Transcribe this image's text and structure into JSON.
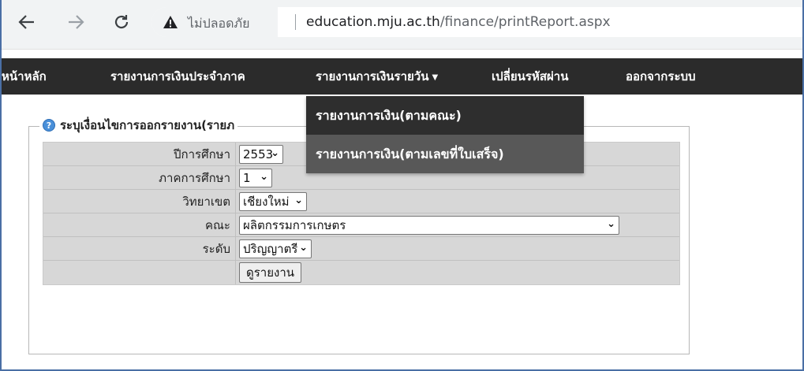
{
  "browser": {
    "security_label": "ไม่ปลอดภัย",
    "url_host": "education.mju.ac.th",
    "url_path": "/finance/printReport.aspx"
  },
  "menu": {
    "items": [
      {
        "label": "หน้าหลัก"
      },
      {
        "label": "รายงานการเงินประจำภาค"
      },
      {
        "label": "รายงานการเงินรายวัน"
      },
      {
        "label": "เปลี่ยนรหัสผ่าน"
      },
      {
        "label": "ออกจากระบบ"
      }
    ],
    "dropdown": [
      {
        "label": "รายงานการเงิน(ตามคณะ)"
      },
      {
        "label": "รายงานการเงิน(ตามเลขที่ใบเสร็จ)"
      }
    ]
  },
  "form": {
    "legend": "ระบุเงื่อนไขการออกรายงาน(รายภ",
    "fields": [
      {
        "label": "ปีการศึกษา",
        "value": "2553"
      },
      {
        "label": "ภาคการศึกษา",
        "value": "1"
      },
      {
        "label": "วิทยาเขต",
        "value": "เชียงใหม่"
      },
      {
        "label": "คณะ",
        "value": "ผลิตกรรมการเกษตร"
      },
      {
        "label": "ระดับ",
        "value": "ปริญญาตรี"
      }
    ],
    "submit_label": "ดูรายงาน"
  },
  "colors": {
    "menubar": "#2b2b2b",
    "dropdown_highlight": "#585858",
    "form_cell": "#d7d7d7"
  }
}
